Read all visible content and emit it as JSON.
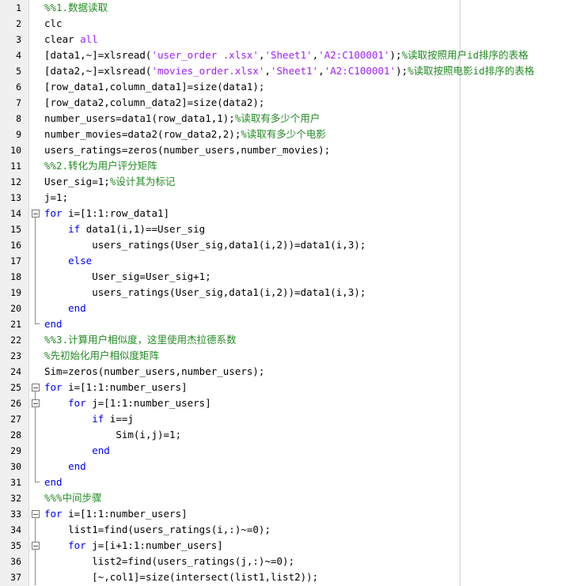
{
  "colors": {
    "keyword": "#0000ff",
    "comment": "#228b22",
    "string": "#a020f0",
    "plain": "#000000",
    "gutter": "#f0f0f0"
  },
  "lines": [
    {
      "n": "1",
      "indent": 0,
      "fold": "none",
      "tokens": [
        {
          "t": "comment",
          "s": "%%1.数据读取"
        }
      ]
    },
    {
      "n": "2",
      "indent": 0,
      "fold": "none",
      "tokens": [
        {
          "t": "plain",
          "s": "clc"
        }
      ]
    },
    {
      "n": "3",
      "indent": 0,
      "fold": "none",
      "tokens": [
        {
          "t": "plain",
          "s": "clear "
        },
        {
          "t": "string",
          "s": "all"
        }
      ]
    },
    {
      "n": "4",
      "indent": 0,
      "fold": "none",
      "tokens": [
        {
          "t": "plain",
          "s": "[data1,~]=xlsread("
        },
        {
          "t": "string",
          "s": "'user_order .xlsx'"
        },
        {
          "t": "plain",
          "s": ","
        },
        {
          "t": "string",
          "s": "'Sheet1'"
        },
        {
          "t": "plain",
          "s": ","
        },
        {
          "t": "string",
          "s": "'A2:C100001'"
        },
        {
          "t": "plain",
          "s": ");"
        },
        {
          "t": "comment",
          "s": "%读取按照用户id排序的表格"
        }
      ]
    },
    {
      "n": "5",
      "indent": 0,
      "fold": "none",
      "tokens": [
        {
          "t": "plain",
          "s": "[data2,~]=xlsread("
        },
        {
          "t": "string",
          "s": "'movies_order.xlsx'"
        },
        {
          "t": "plain",
          "s": ","
        },
        {
          "t": "string",
          "s": "'Sheet1'"
        },
        {
          "t": "plain",
          "s": ","
        },
        {
          "t": "string",
          "s": "'A2:C100001'"
        },
        {
          "t": "plain",
          "s": ");"
        },
        {
          "t": "comment",
          "s": "%读取按照电影id排序的表格"
        }
      ]
    },
    {
      "n": "6",
      "indent": 0,
      "fold": "none",
      "tokens": [
        {
          "t": "plain",
          "s": "[row_data1,column_data1]=size(data1);"
        }
      ]
    },
    {
      "n": "7",
      "indent": 0,
      "fold": "none",
      "tokens": [
        {
          "t": "plain",
          "s": "[row_data2,column_data2]=size(data2);"
        }
      ]
    },
    {
      "n": "8",
      "indent": 0,
      "fold": "none",
      "tokens": [
        {
          "t": "plain",
          "s": "number_users=data1(row_data1,1);"
        },
        {
          "t": "comment",
          "s": "%读取有多少个用户"
        }
      ]
    },
    {
      "n": "9",
      "indent": 0,
      "fold": "none",
      "tokens": [
        {
          "t": "plain",
          "s": "number_movies=data2(row_data2,2);"
        },
        {
          "t": "comment",
          "s": "%读取有多少个电影"
        }
      ]
    },
    {
      "n": "10",
      "indent": 0,
      "fold": "none",
      "tokens": [
        {
          "t": "plain",
          "s": "users_ratings=zeros(number_users,number_movies);"
        }
      ]
    },
    {
      "n": "11",
      "indent": 0,
      "fold": "none",
      "tokens": [
        {
          "t": "comment",
          "s": "%%2.转化为用户评分矩阵"
        }
      ]
    },
    {
      "n": "12",
      "indent": 0,
      "fold": "none",
      "tokens": [
        {
          "t": "plain",
          "s": "User_sig=1;"
        },
        {
          "t": "comment",
          "s": "%设计其为标记"
        }
      ]
    },
    {
      "n": "13",
      "indent": 0,
      "fold": "none",
      "tokens": [
        {
          "t": "plain",
          "s": "j=1;"
        }
      ]
    },
    {
      "n": "14",
      "indent": 0,
      "fold": "start",
      "tokens": [
        {
          "t": "keyword",
          "s": "for"
        },
        {
          "t": "plain",
          "s": " i=[1:1:row_data1]"
        }
      ]
    },
    {
      "n": "15",
      "indent": 1,
      "fold": "bar",
      "tokens": [
        {
          "t": "keyword",
          "s": "if"
        },
        {
          "t": "plain",
          "s": " data1(i,1)==User_sig"
        }
      ]
    },
    {
      "n": "16",
      "indent": 2,
      "fold": "bar",
      "tokens": [
        {
          "t": "plain",
          "s": "users_ratings(User_sig,data1(i,2))=data1(i,3);"
        }
      ]
    },
    {
      "n": "17",
      "indent": 1,
      "fold": "bar",
      "tokens": [
        {
          "t": "keyword",
          "s": "else"
        }
      ]
    },
    {
      "n": "18",
      "indent": 2,
      "fold": "bar",
      "tokens": [
        {
          "t": "plain",
          "s": "User_sig=User_sig+1;"
        }
      ]
    },
    {
      "n": "19",
      "indent": 2,
      "fold": "bar",
      "tokens": [
        {
          "t": "plain",
          "s": "users_ratings(User_sig,data1(i,2))=data1(i,3);"
        }
      ]
    },
    {
      "n": "20",
      "indent": 1,
      "fold": "bar",
      "tokens": [
        {
          "t": "keyword",
          "s": "end"
        }
      ]
    },
    {
      "n": "21",
      "indent": 0,
      "fold": "end",
      "tokens": [
        {
          "t": "keyword",
          "s": "end"
        }
      ]
    },
    {
      "n": "22",
      "indent": 0,
      "fold": "none",
      "tokens": [
        {
          "t": "comment",
          "s": "%%3.计算用户相似度，这里使用杰拉德系数"
        }
      ]
    },
    {
      "n": "23",
      "indent": 0,
      "fold": "none",
      "tokens": [
        {
          "t": "comment",
          "s": "%先初始化用户相似度矩阵"
        }
      ]
    },
    {
      "n": "24",
      "indent": 0,
      "fold": "none",
      "tokens": [
        {
          "t": "plain",
          "s": "Sim=zeros(number_users,number_users);"
        }
      ]
    },
    {
      "n": "25",
      "indent": 0,
      "fold": "start",
      "tokens": [
        {
          "t": "keyword",
          "s": "for"
        },
        {
          "t": "plain",
          "s": " i=[1:1:number_users]"
        }
      ]
    },
    {
      "n": "26",
      "indent": 1,
      "fold": "start",
      "tokens": [
        {
          "t": "keyword",
          "s": "for"
        },
        {
          "t": "plain",
          "s": " j=[1:1:number_users]"
        }
      ]
    },
    {
      "n": "27",
      "indent": 2,
      "fold": "bar",
      "tokens": [
        {
          "t": "keyword",
          "s": "if"
        },
        {
          "t": "plain",
          "s": " i==j"
        }
      ]
    },
    {
      "n": "28",
      "indent": 3,
      "fold": "bar",
      "tokens": [
        {
          "t": "plain",
          "s": "Sim(i,j)=1;"
        }
      ]
    },
    {
      "n": "29",
      "indent": 2,
      "fold": "bar",
      "tokens": [
        {
          "t": "keyword",
          "s": "end"
        }
      ]
    },
    {
      "n": "30",
      "indent": 1,
      "fold": "bar",
      "tokens": [
        {
          "t": "keyword",
          "s": "end"
        }
      ]
    },
    {
      "n": "31",
      "indent": 0,
      "fold": "end",
      "tokens": [
        {
          "t": "keyword",
          "s": "end"
        }
      ]
    },
    {
      "n": "32",
      "indent": 0,
      "fold": "none",
      "tokens": [
        {
          "t": "comment",
          "s": "%%%中间步骤"
        }
      ]
    },
    {
      "n": "33",
      "indent": 0,
      "fold": "start",
      "tokens": [
        {
          "t": "keyword",
          "s": "for"
        },
        {
          "t": "plain",
          "s": " i=[1:1:number_users]"
        }
      ]
    },
    {
      "n": "34",
      "indent": 1,
      "fold": "bar",
      "tokens": [
        {
          "t": "plain",
          "s": "list1=find(users_ratings(i,:)~=0);"
        }
      ]
    },
    {
      "n": "35",
      "indent": 1,
      "fold": "start",
      "tokens": [
        {
          "t": "keyword",
          "s": "for"
        },
        {
          "t": "plain",
          "s": " j=[i+1:1:number_users]"
        }
      ]
    },
    {
      "n": "36",
      "indent": 2,
      "fold": "bar",
      "tokens": [
        {
          "t": "plain",
          "s": "list2=find(users_ratings(j,:)~=0);"
        }
      ]
    },
    {
      "n": "37",
      "indent": 2,
      "fold": "bar",
      "tokens": [
        {
          "t": "plain",
          "s": "[~,col1]=size(intersect(list1,list2));"
        }
      ]
    }
  ]
}
